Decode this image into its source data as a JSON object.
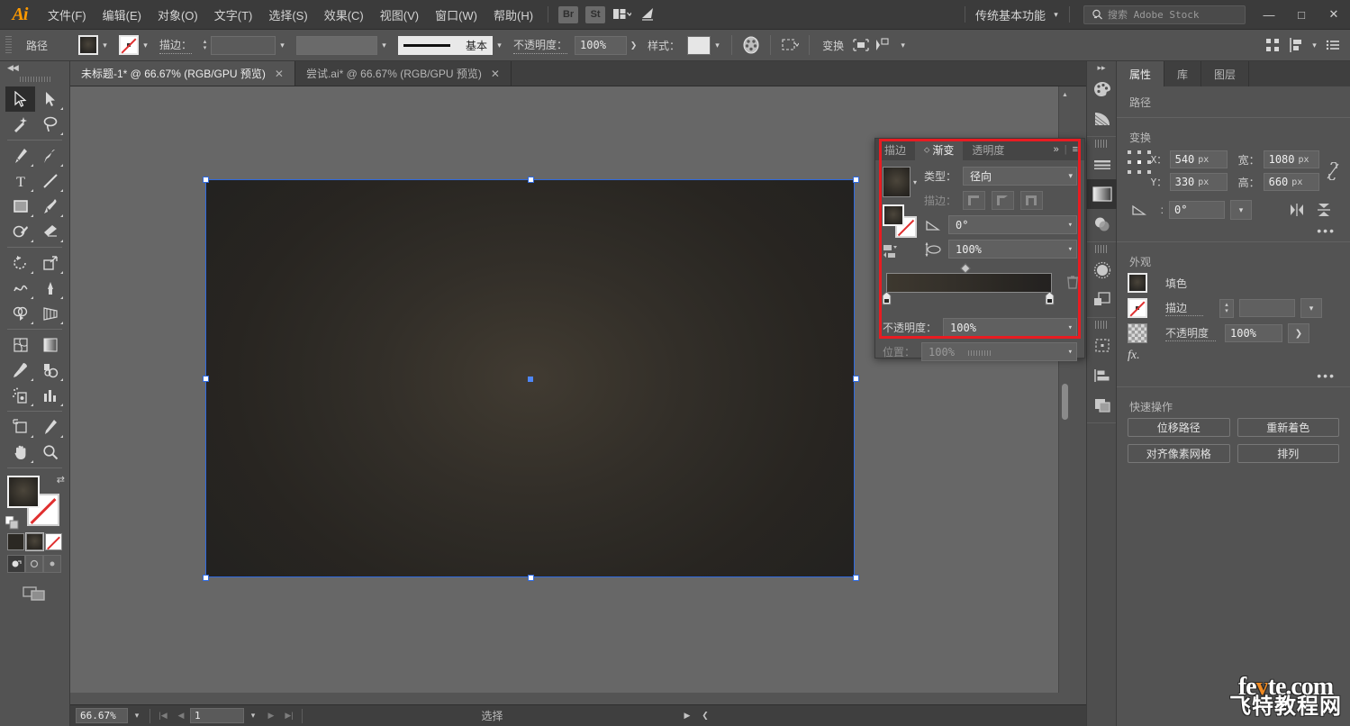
{
  "app": {
    "logo": "Ai",
    "menus": [
      {
        "label": "文件(F)"
      },
      {
        "label": "编辑(E)"
      },
      {
        "label": "对象(O)"
      },
      {
        "label": "文字(T)"
      },
      {
        "label": "选择(S)"
      },
      {
        "label": "效果(C)"
      },
      {
        "label": "视图(V)"
      },
      {
        "label": "窗口(W)"
      },
      {
        "label": "帮助(H)"
      }
    ],
    "bridge_button": "Br",
    "stock_button": "St",
    "workspace": "传统基本功能",
    "search_placeholder": "搜索 Adobe Stock",
    "window_minimize": "—",
    "window_maximize": "□",
    "window_close": "✕"
  },
  "controlbar": {
    "object_type": "路径",
    "fill_label": "填色",
    "stroke_label": "描边：",
    "stroke_weight": "",
    "stroke_profile": "基本",
    "opacity_label": "不透明度：",
    "opacity_value": "100%",
    "style_label": "样式：",
    "transform_label": "变换",
    "recolor_label": "重新着色"
  },
  "tabs": [
    {
      "title": "未标题-1* @ 66.67% (RGB/GPU 预览)",
      "active": true,
      "close": "✕"
    },
    {
      "title": "尝试.ai* @ 66.67% (RGB/GPU 预览)",
      "active": false,
      "close": "✕"
    }
  ],
  "toolbar": {
    "tools": [
      {
        "name": "selection-tool",
        "selected": true
      },
      {
        "name": "direct-selection-tool",
        "selected": false
      },
      {
        "name": "magic-wand-tool",
        "selected": false
      },
      {
        "name": "lasso-tool",
        "selected": false
      },
      {
        "name": "pen-tool",
        "selected": false
      },
      {
        "name": "curvature-tool",
        "selected": false
      },
      {
        "name": "type-tool",
        "selected": false
      },
      {
        "name": "line-segment-tool",
        "selected": false
      },
      {
        "name": "rectangle-tool",
        "selected": false
      },
      {
        "name": "paintbrush-tool",
        "selected": false
      },
      {
        "name": "shaper-tool",
        "selected": false
      },
      {
        "name": "eraser-tool",
        "selected": false
      },
      {
        "name": "rotate-tool",
        "selected": false
      },
      {
        "name": "scale-tool",
        "selected": false
      },
      {
        "name": "width-tool",
        "selected": false
      },
      {
        "name": "free-transform-tool",
        "selected": false
      },
      {
        "name": "shape-builder-tool",
        "selected": false
      },
      {
        "name": "perspective-grid-tool",
        "selected": false
      },
      {
        "name": "mesh-tool",
        "selected": false
      },
      {
        "name": "gradient-tool",
        "selected": false
      },
      {
        "name": "eyedropper-tool",
        "selected": false
      },
      {
        "name": "blend-tool",
        "selected": false
      },
      {
        "name": "symbol-sprayer-tool",
        "selected": false
      },
      {
        "name": "column-graph-tool",
        "selected": false
      },
      {
        "name": "artboard-tool",
        "selected": false
      },
      {
        "name": "slice-tool",
        "selected": false
      },
      {
        "name": "hand-tool",
        "selected": false
      },
      {
        "name": "zoom-tool",
        "selected": false
      }
    ]
  },
  "gradient_panel": {
    "tabs": [
      {
        "label": "描边",
        "active": false
      },
      {
        "label": "渐变",
        "active": true
      },
      {
        "label": "透明度",
        "active": false
      }
    ],
    "collapse_icon": "»",
    "menu_icon": "≡",
    "type_label": "类型：",
    "type_value": "径向",
    "stroke_label": "描边：",
    "angle_label": "角度",
    "angle_value": "0°",
    "aspect_label": "长宽比",
    "aspect_value": "100%",
    "opacity_label": "不透明度：",
    "opacity_value": "100%",
    "location_label": "位置：",
    "location_value": "100%"
  },
  "properties": {
    "tabs": [
      {
        "label": "属性",
        "active": true
      },
      {
        "label": "库",
        "active": false
      },
      {
        "label": "图层",
        "active": false
      }
    ],
    "object_heading": "路径",
    "transform_heading": "变换",
    "x_label": "X：",
    "x_value": "540",
    "x_unit": "px",
    "y_label": "Y：",
    "y_value": "330",
    "y_unit": "px",
    "w_label": "宽：",
    "w_value": "1080",
    "w_unit": "px",
    "h_label": "高：",
    "h_value": "660",
    "h_unit": "px",
    "angle_label": "角度",
    "angle_value": "0°",
    "more_options": "•••",
    "appearance_heading": "外观",
    "fill_label": "填色",
    "stroke_label": "描边",
    "stroke_weight": "",
    "opacity_label": "不透明度",
    "opacity_value": "100%",
    "fx_label": "fx.",
    "appearance_more": "•••",
    "quickactions_heading": "快速操作",
    "quick_actions": [
      {
        "label": "位移路径"
      },
      {
        "label": "重新着色"
      },
      {
        "label": "对齐像素网格"
      },
      {
        "label": "排列"
      }
    ]
  },
  "statusbar": {
    "zoom": "66.67%",
    "page": "1",
    "status_text": "选择"
  },
  "watermark": {
    "line1_a": "fe",
    "line1_b": "v",
    "line1_c": "te.com",
    "line2": "飞特教程网"
  },
  "colors": {
    "chrome_bg": "#535353",
    "dark_chrome": "#3b3b3b",
    "canvas_bg": "#676767",
    "accent_red": "#e81c22",
    "selection_blue": "#2f6ae0",
    "orange_logo": "#ff9a00"
  }
}
